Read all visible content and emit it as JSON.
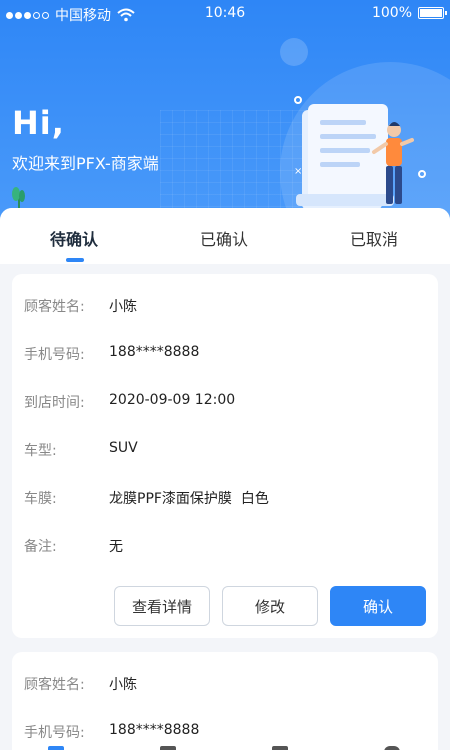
{
  "status_bar": {
    "carrier": "中国移动",
    "time": "10:46",
    "battery": "100%"
  },
  "header": {
    "greeting": "Hi,",
    "subtitle": "欢迎来到PFX-商家端"
  },
  "tabs": [
    {
      "label": "待确认",
      "active": true
    },
    {
      "label": "已确认",
      "active": false
    },
    {
      "label": "已取消",
      "active": false
    }
  ],
  "orders": [
    {
      "fields": [
        {
          "label": "顾客姓名:",
          "value": "小陈"
        },
        {
          "label": "手机号码:",
          "value": "188****8888"
        },
        {
          "label": "到店时间:",
          "value": "2020-09-09 12:00"
        },
        {
          "label": "车型:",
          "value": "SUV"
        },
        {
          "label": "车膜:",
          "value": "龙膜PPF漆面保护膜  白色"
        },
        {
          "label": "备注:",
          "value": "无"
        }
      ],
      "buttons": {
        "details": "查看详情",
        "edit": "修改",
        "confirm": "确认"
      }
    },
    {
      "fields": [
        {
          "label": "顾客姓名:",
          "value": "小陈"
        },
        {
          "label": "手机号码:",
          "value": "188****8888"
        }
      ]
    }
  ],
  "colors": {
    "accent": "#2e86f6",
    "background": "#f3f5f9"
  },
  "icons": {
    "wifi": "wifi-icon",
    "battery": "battery-icon",
    "illustration": "document-person-illustration"
  }
}
